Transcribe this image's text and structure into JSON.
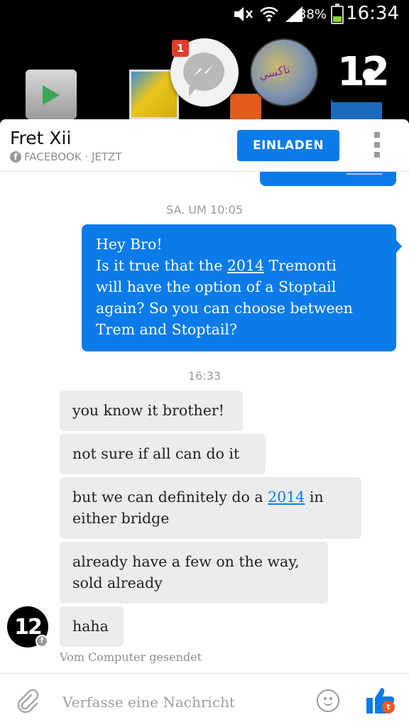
{
  "status_bar": {
    "battery": "38%",
    "time": "16:34"
  },
  "chat_heads": {
    "unread_count": "1",
    "logo": "12"
  },
  "header": {
    "contact_name": "Fret Xii",
    "subtitle": "FACEBOOK · JETZT",
    "invite_label": "EINLADEN"
  },
  "messages": {
    "timestamp_1": "SA. UM 10:05",
    "outgoing": {
      "line1": "Hey Bro!",
      "line2_pre": "Is it true that the ",
      "line2_link": "2014",
      "line2_post": " Tremonti",
      "line3": "will have the option of a Stoptail",
      "line4": "again? So you can choose between",
      "line5": "Trem and Stoptail?"
    },
    "timestamp_2": "16:33",
    "incoming": [
      {
        "text": "you know it brother!"
      },
      {
        "text": "not sure if all can do it"
      },
      {
        "pre": "but we can definitely do a ",
        "link": "2014",
        "post": " in",
        "line2": "either bridge"
      },
      {
        "line1": "already have a few on the way,",
        "line2": "sold already"
      },
      {
        "text": "haha"
      }
    ],
    "sent_from": "Vom Computer gesendet"
  },
  "composer": {
    "placeholder": "Verfasse eine Nachricht"
  },
  "colors": {
    "accent": "#0b7bea",
    "incoming_bubble": "#ececec"
  }
}
